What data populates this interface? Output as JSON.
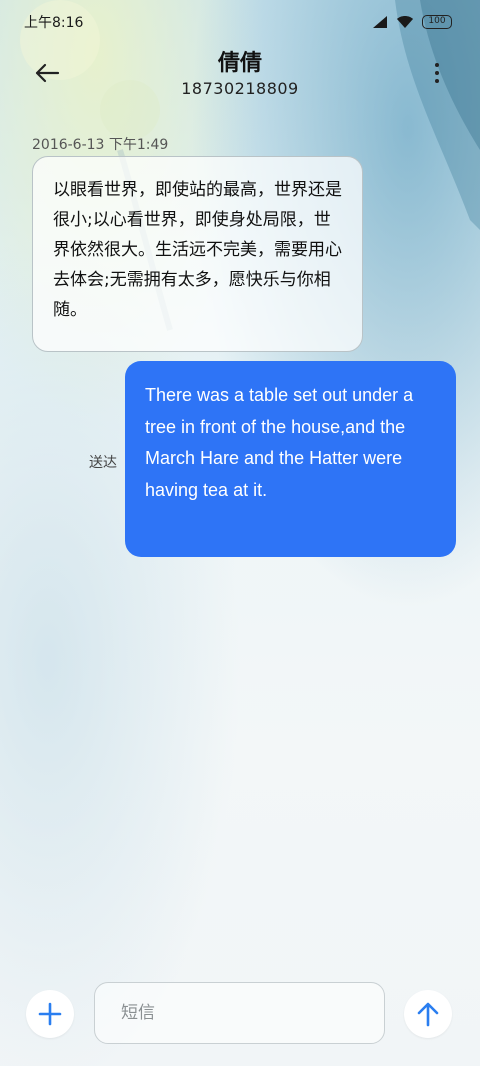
{
  "status_bar": {
    "time": "上午8:16",
    "battery": "100"
  },
  "header": {
    "contact_name": "倩倩",
    "contact_number": "18730218809"
  },
  "conversation": {
    "timestamp": "2016-6-13 下午1:49",
    "incoming_message": "以眼看世界，即使站的最高，世界还是很小;以心看世界，即使身处局限，世界依然很大。生活远不完美，需要用心去体会;无需拥有太多，愿快乐与你相随。",
    "outgoing_message": "There was a table set out under a tree in front of the house,and the March Hare and the Hatter were having tea at it.",
    "outgoing_status": "送达"
  },
  "composer": {
    "placeholder": "短信"
  },
  "colors": {
    "accent": "#2e74f6",
    "icon_blue": "#2a7ef0"
  },
  "icons": {
    "back": "arrow-left-icon",
    "more": "more-vertical-icon",
    "add": "plus-icon",
    "send": "arrow-up-icon",
    "signal": "signal-icon",
    "wifi": "wifi-icon"
  }
}
